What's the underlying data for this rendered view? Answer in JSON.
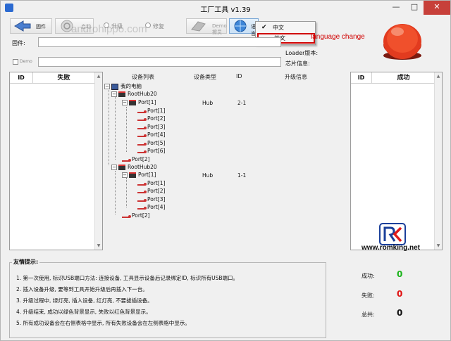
{
  "window": {
    "title": "工厂工具 v1.39"
  },
  "titlebar_buttons": {
    "minimize": "—",
    "maximize": "□",
    "close": "✕"
  },
  "toolbar": {
    "firmware": {
      "label": "固件",
      "icon": "firmware-arrow-icon"
    },
    "start": {
      "label": "启动",
      "icon": "power-icon"
    },
    "upgrade": {
      "label": "升级"
    },
    "repair": {
      "label": "修复"
    },
    "demo": {
      "label": "Demo擦员"
    },
    "language": {
      "label": "语言",
      "icon": "globe-icon"
    }
  },
  "language_menu": {
    "items": [
      {
        "label": "中文",
        "checked": true
      },
      {
        "label": "英文",
        "checked": false
      }
    ]
  },
  "annotation": "language change",
  "watermark": "androhippo.com",
  "fields": {
    "firmware_label": "固件:",
    "demo_label": "Demo",
    "loader_label": "Loader版本:",
    "chip_label": "芯片信息:"
  },
  "fail_panel": {
    "id_header": "ID",
    "title": "失败"
  },
  "success_panel": {
    "id_header": "ID",
    "title": "成功"
  },
  "device_list": {
    "headers": [
      "设备列表",
      "设备类型",
      "ID",
      "升级信息"
    ],
    "root": "我的电脑",
    "hubs": [
      {
        "name": "RootHub20",
        "port": "Port[1]",
        "type": "Hub",
        "id": "2-1",
        "subports": [
          "Port[1]",
          "Port[2]",
          "Port[3]",
          "Port[4]",
          "Port[5]",
          "Port[6]"
        ],
        "extra_port": "Port[2]"
      },
      {
        "name": "RootHub20",
        "port": "Port[1]",
        "type": "Hub",
        "id": "1-1",
        "subports": [
          "Port[1]",
          "Port[2]",
          "Port[3]",
          "Port[4]"
        ],
        "extra_port": "Port[2]"
      }
    ]
  },
  "tips": {
    "title": "友情提示:",
    "items": [
      "1. 第一次使用, 标识USB端口方法: 连接设备, 工具显示设备后记录绑定ID, 标识所有USB端口。",
      "2. 插入设备升级, 要等到工具开始升级后再插入下一台。",
      "3. 升级过程中, 绿灯亮, 插入设备, 红灯亮, 不要拔插设备。",
      "4. 升级结束, 成功以绿色背景显示, 失败以红色背景显示。",
      "5. 所有成功设备会在右侧表格中显示, 所有失败设备会在左侧表格中显示。"
    ]
  },
  "stats": {
    "success_label": "成功:",
    "success_value": "0",
    "success_color": "#19b319",
    "fail_label": "失败:",
    "fail_value": "0",
    "fail_color": "#e01010",
    "total_label": "总共:",
    "total_value": "0",
    "total_color": "#111111"
  },
  "romking": {
    "url": "www.romking.net"
  }
}
